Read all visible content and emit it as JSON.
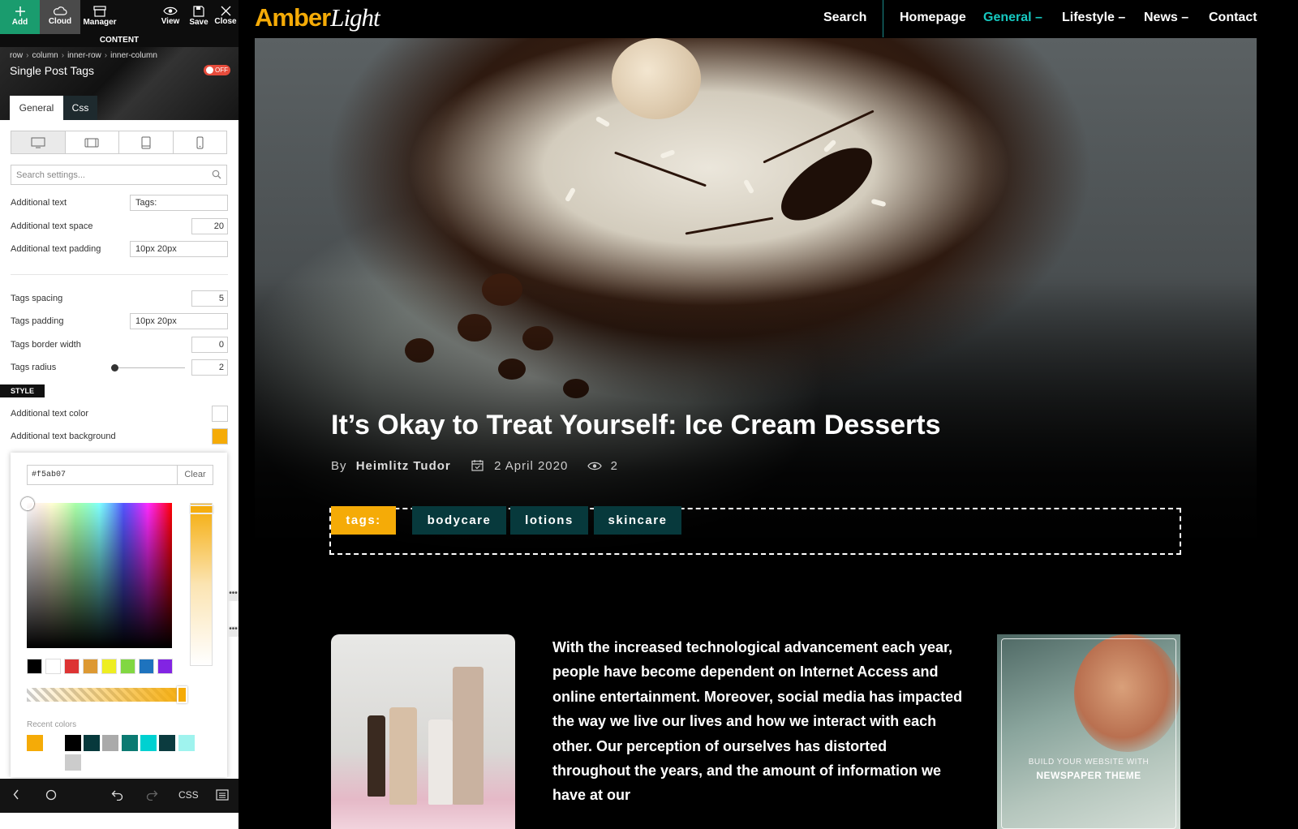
{
  "toolbar": {
    "add": "Add",
    "cloud": "Cloud",
    "manager": "Manager",
    "view": "View",
    "save": "Save",
    "close": "Close"
  },
  "content_bar": "CONTENT",
  "breadcrumb": [
    "row",
    "column",
    "inner-row",
    "inner-column"
  ],
  "element_title": "Single Post Tags",
  "toggle_label": "OFF",
  "panel_tabs": [
    "General",
    "Css"
  ],
  "search": {
    "placeholder": "Search settings..."
  },
  "settings": {
    "additional_text": {
      "label": "Additional text",
      "value": "Tags:"
    },
    "additional_text_space": {
      "label": "Additional text space",
      "value": "20"
    },
    "additional_text_padding": {
      "label": "Additional text padding",
      "value": "10px 20px"
    },
    "tags_spacing": {
      "label": "Tags spacing",
      "value": "5"
    },
    "tags_padding": {
      "label": "Tags padding",
      "value": "10px 20px"
    },
    "tags_border_width": {
      "label": "Tags border width",
      "value": "0"
    },
    "tags_radius": {
      "label": "Tags radius",
      "value": "2"
    }
  },
  "style_section": "STYLE",
  "style": {
    "additional_text_color": {
      "label": "Additional text color",
      "value": "#ffffff"
    },
    "additional_text_background": {
      "label": "Additional text background",
      "value": "#f5ab07"
    }
  },
  "color_picker": {
    "hex": "#f5ab07",
    "clear": "Clear",
    "presets": [
      "#000000",
      "#ffffff",
      "#dd3333",
      "#dd9933",
      "#eeee22",
      "#81d742",
      "#1e73be",
      "#8224e3"
    ],
    "recent_label": "Recent colors",
    "recent": [
      "#f5ab07",
      "#ffffff",
      "#000000",
      "#07393c",
      "#aaaaaa",
      "#0b7a72",
      "#00d1d1",
      "#0b3b3f",
      "#9ff3ee",
      "#cccccc"
    ]
  },
  "bottom_bar": {
    "css": "CSS"
  },
  "site": {
    "logo_main": "Amber",
    "logo_accent": "Light",
    "nav_search": "Search",
    "nav": [
      "Homepage",
      "General –",
      "Lifestyle –",
      "News –",
      "Contact"
    ],
    "active_nav": "General –",
    "accent_color": "#16c8c0"
  },
  "post": {
    "title": "It’s Okay to Treat Yourself: Ice Cream Desserts",
    "by": "By",
    "author": "Heimlitz Tudor",
    "date": "2 April 2020",
    "views": "2",
    "tags_label": "tags:",
    "tags": [
      "bodycare",
      "lotions",
      "skincare"
    ],
    "body": "With the increased technological advancement each year, people have become dependent on Internet Access and online entertainment. Moreover, social media has impacted the way we live our lives and how we interact with each other. Our perception of ourselves has distorted throughout the years, and the amount of information we have at our"
  },
  "ad": {
    "line1": "BUILD YOUR WEBSITE WITH",
    "line2": "NEWSPAPER THEME"
  }
}
